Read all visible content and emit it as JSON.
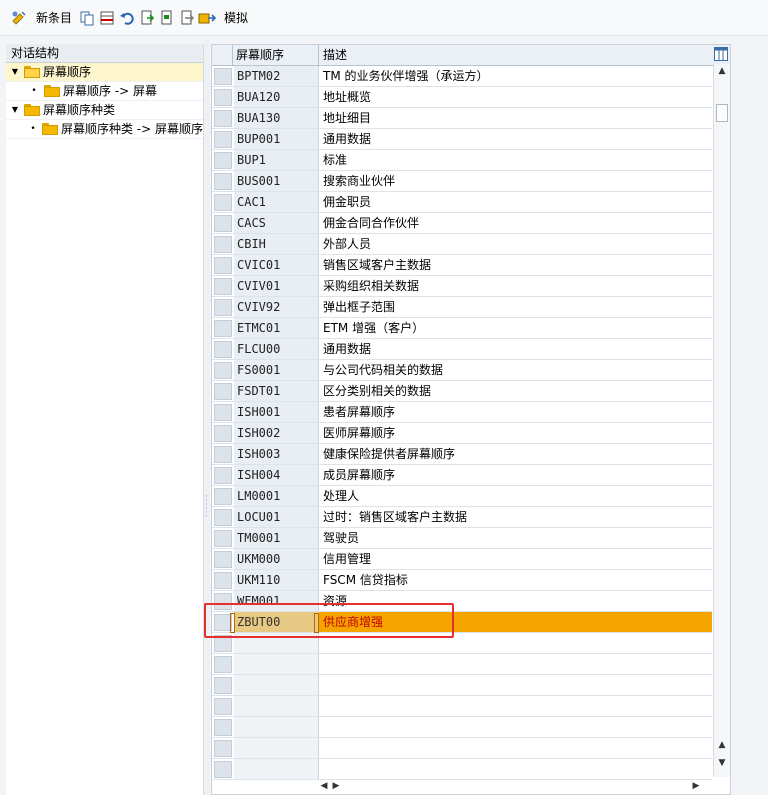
{
  "toolbar": {
    "new_entries_label": "新条目",
    "simulate_label": "模拟",
    "icons": [
      "display-change-icon",
      "new-entries-icon",
      "copy-icon",
      "delete-icon",
      "undo-icon",
      "select-all-icon",
      "select-block-icon",
      "deselect-all-icon",
      "transport-icon",
      "simulate-icon"
    ]
  },
  "tree": {
    "header": "对话结构",
    "items": [
      {
        "label": "屏幕顺序",
        "level": 0,
        "expanded": true,
        "selected": true
      },
      {
        "label": "屏幕顺序 -> 屏幕",
        "level": 1
      },
      {
        "label": "屏幕顺序种类",
        "level": 0,
        "expanded": true
      },
      {
        "label": "屏幕顺序种类 -> 屏幕顺序",
        "level": 1
      }
    ]
  },
  "table": {
    "columns": [
      "屏幕顺序",
      "描述"
    ],
    "rows": [
      {
        "code": "BPTM02",
        "desc": "TM 的业务伙伴增强（承运方）"
      },
      {
        "code": "BUA120",
        "desc": "地址概览"
      },
      {
        "code": "BUA130",
        "desc": "地址细目"
      },
      {
        "code": "BUP001",
        "desc": "通用数据"
      },
      {
        "code": "BUP1",
        "desc": "标准"
      },
      {
        "code": "BUS001",
        "desc": "搜索商业伙伴"
      },
      {
        "code": "CAC1",
        "desc": "佣金职员"
      },
      {
        "code": "CACS",
        "desc": "佣金合同合作伙伴"
      },
      {
        "code": "CBIH",
        "desc": "外部人员"
      },
      {
        "code": "CVIC01",
        "desc": "销售区域客户主数据"
      },
      {
        "code": "CVIV01",
        "desc": "采购组织相关数据"
      },
      {
        "code": "CVIV92",
        "desc": "弹出框子范围"
      },
      {
        "code": "ETMC01",
        "desc": "ETM 增强（客户）"
      },
      {
        "code": "FLCU00",
        "desc": "通用数据"
      },
      {
        "code": "FS0001",
        "desc": "与公司代码相关的数据"
      },
      {
        "code": "FSDT01",
        "desc": "区分类别相关的数据"
      },
      {
        "code": "ISH001",
        "desc": "患者屏幕顺序"
      },
      {
        "code": "ISH002",
        "desc": "医师屏幕顺序"
      },
      {
        "code": "ISH003",
        "desc": "健康保险提供者屏幕顺序"
      },
      {
        "code": "ISH004",
        "desc": "成员屏幕顺序"
      },
      {
        "code": "LM0001",
        "desc": "处理人"
      },
      {
        "code": "LOCU01",
        "desc": "过时：销售区域客户主数据"
      },
      {
        "code": "TM0001",
        "desc": "驾驶员"
      },
      {
        "code": "UKM000",
        "desc": "信用管理"
      },
      {
        "code": "UKM110",
        "desc": "FSCM 信贷指标"
      },
      {
        "code": "WFM001",
        "desc": "资源"
      },
      {
        "code": "ZBUT00",
        "desc": "供应商增强",
        "active": true
      }
    ],
    "empty_rows": 7
  },
  "colors": {
    "active_row": "#f6a400",
    "active_text": "#c00000",
    "highlight_box": "#e53030"
  }
}
